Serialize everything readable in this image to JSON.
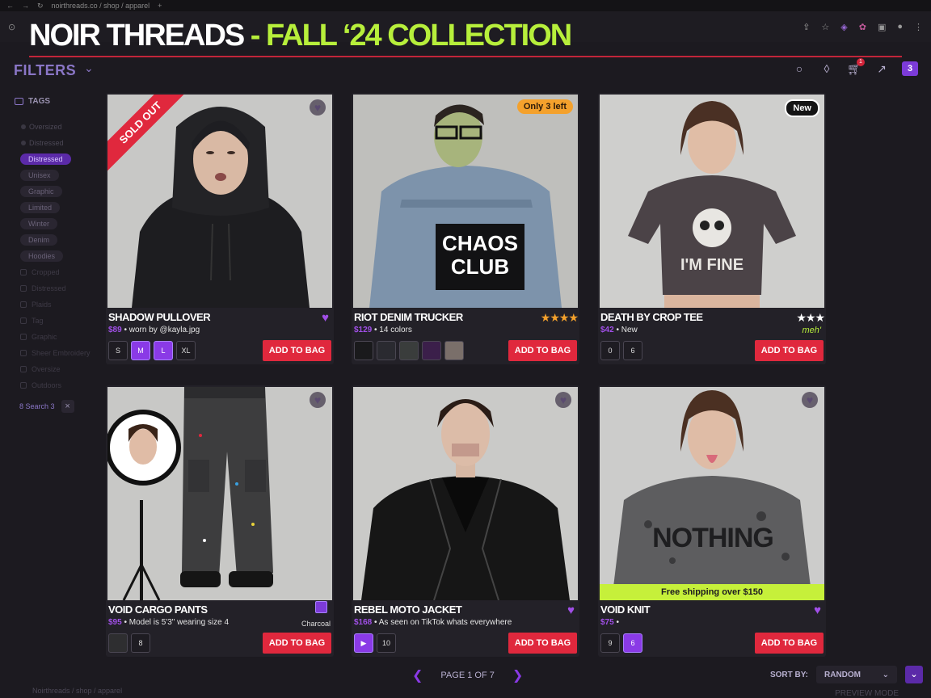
{
  "browser": {
    "url": "noirthreads.co / shop / apparel",
    "new_tab": "+"
  },
  "hero": {
    "brand": "NOIR THREADS",
    "separator": " - ",
    "collection": "FALL ‘24 COLLECTION"
  },
  "topbar": {
    "filters_label": "FILTERS",
    "cart_badge": "1",
    "count": "3"
  },
  "sidebar": {
    "tags_title": "TAGS",
    "radios": [
      "Oversized",
      "Distressed"
    ],
    "chips": [
      {
        "label": "Distressed",
        "active": true
      },
      {
        "label": "Unisex",
        "active": false
      },
      {
        "label": "Graphic",
        "active": false
      },
      {
        "label": "Limited",
        "active": false
      },
      {
        "label": "Winter",
        "active": false
      },
      {
        "label": "Denim",
        "active": false
      },
      {
        "label": "Hoodies",
        "active": false
      }
    ],
    "checkboxes": [
      "Cropped",
      "Distressed",
      "Plaids",
      "Tag",
      "Graphic",
      "Sheer Embroidery",
      "Oversize",
      "Outdoors"
    ],
    "search_label": "8 Search 3"
  },
  "products": [
    {
      "name": "SHADOW PULLOVER",
      "price": "$89",
      "sub": " • worn by @kayla.jpg",
      "badge": "SOLD OUT",
      "sizes": [
        "S",
        "M",
        "L",
        "XL"
      ],
      "selected": [
        "M",
        "L"
      ],
      "cta": "ADD TO BAG"
    },
    {
      "name": "RIOT DENIM TRUCKER",
      "price": "$129",
      "sub": " • 14 colors",
      "badge": "Only 3 left",
      "stars": "★★★★",
      "photo_text": "CHAOS\nCLUB",
      "swatches": [
        "#1a1a1c",
        "#2a2a30",
        "#3a3d3c",
        "#3b1f4a",
        "#7a6f6a"
      ],
      "cta": "ADD TO BAG"
    },
    {
      "name": "DEATH BY CROP TEE",
      "price": "$42",
      "sub": " • New",
      "badge": "New",
      "stars": "★★★",
      "note": "meh'",
      "photo_text": "I'M FINE",
      "sizes": [
        "0",
        "6"
      ],
      "cta": "ADD TO BAG"
    },
    {
      "name": "VOID CARGO PANTS",
      "price": "$95",
      "sub": " • Model is 5'3\" wearing size 4",
      "color_name": "Charcoal",
      "sizes": [
        "8"
      ],
      "cta": "ADD TO BAG"
    },
    {
      "name": "REBEL MOTO JACKET",
      "price": "$168",
      "sub": " • As seen on TikTok whats everywhere",
      "sizes": [
        "10"
      ],
      "play": "▶",
      "cta": "ADD TO BAG"
    },
    {
      "name": "VOID KNIT",
      "price": "$75",
      "sub": " •",
      "promo": "Free shipping over $150",
      "photo_text": "NOTHING",
      "sizes": [
        "9",
        "6"
      ],
      "selected": [
        "6"
      ],
      "cta": "ADD TO BAG"
    }
  ],
  "pagination": {
    "prev": "❮",
    "label": "PAGE 1 OF 7",
    "next": "❯"
  },
  "sort": {
    "label": "SORT BY:",
    "value": "RANDOM"
  },
  "footer": {
    "left": "Noirthreads / shop / apparel",
    "preview": "PREVIEW MODE"
  },
  "colors": {
    "accent_purple": "#8a3ae6",
    "accent_lime": "#b7ef3b",
    "cta_red": "#e0283d"
  }
}
